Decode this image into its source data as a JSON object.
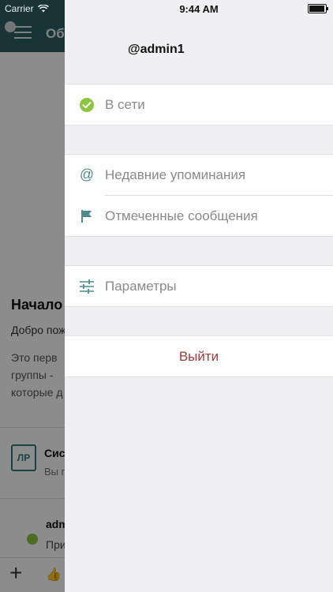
{
  "status_bar": {
    "carrier": "Carrier",
    "time": "9:44 AM"
  },
  "background": {
    "header_title": "Об",
    "heading": "Начало",
    "welcome": "Добро пож",
    "paragraph_lines": [
      "Это перв",
      "группы -",
      "которые д"
    ],
    "message1_title": "Сис",
    "message1_sub": "Вы п",
    "message1_avatar": "ЛР",
    "message2_title": "adm",
    "message2_sub": "При"
  },
  "drawer": {
    "username": "@admin1",
    "status_label": "В сети",
    "menu": [
      {
        "label": "Недавние упоминания",
        "icon": "at-icon"
      },
      {
        "label": "Отмеченные сообщения",
        "icon": "flag-icon"
      }
    ],
    "settings_label": "Параметры",
    "logout_label": "Выйти"
  },
  "colors": {
    "header": "#2f5f60",
    "online": "#8cc63f",
    "icon_teal": "#4f8d8a",
    "logout": "#a53a3a"
  }
}
